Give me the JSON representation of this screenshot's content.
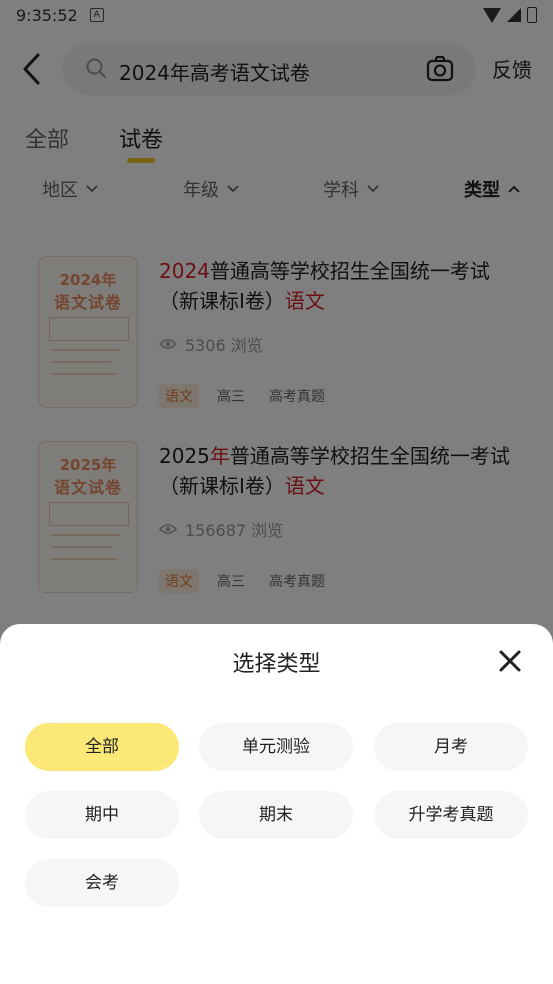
{
  "status_bar": {
    "time": "9:35:52",
    "notification_icon": "A"
  },
  "header": {
    "search_query": "2024年高考语文试卷",
    "feedback_label": "反馈"
  },
  "tabs": [
    {
      "label": "全部"
    },
    {
      "label": "试卷"
    }
  ],
  "filters": [
    {
      "label": "地区"
    },
    {
      "label": "年级"
    },
    {
      "label": "学科"
    },
    {
      "label": "类型"
    }
  ],
  "results": [
    {
      "cover_year": "2024年",
      "cover_title": "语文试卷",
      "title_prefix_red": "2024",
      "title_main": "普通高等学校招生全国统一考试（新课标I卷）",
      "title_suffix_red": "语文",
      "views": "5306 浏览",
      "tags": [
        "语文",
        "高三",
        "高考真题"
      ]
    },
    {
      "cover_year": "2025年",
      "cover_title": "语文试卷",
      "title_prefix": "2025",
      "title_prefix_red": "年",
      "title_main": "普通高等学校招生全国统一考试（新课标I卷）",
      "title_suffix_red": "语文",
      "views": "156687 浏览",
      "tags": [
        "语文",
        "高三",
        "高考真题"
      ]
    }
  ],
  "sheet": {
    "title": "选择类型",
    "options": [
      "全部",
      "单元测验",
      "月考",
      "期中",
      "期末",
      "升学考真题",
      "会考"
    ],
    "selected": "全部"
  },
  "colors": {
    "accent_yellow": "#fbe877",
    "tab_indicator": "#f3c82b",
    "highlight_red": "#d8202a",
    "subject_tag": "#e67a3a"
  }
}
